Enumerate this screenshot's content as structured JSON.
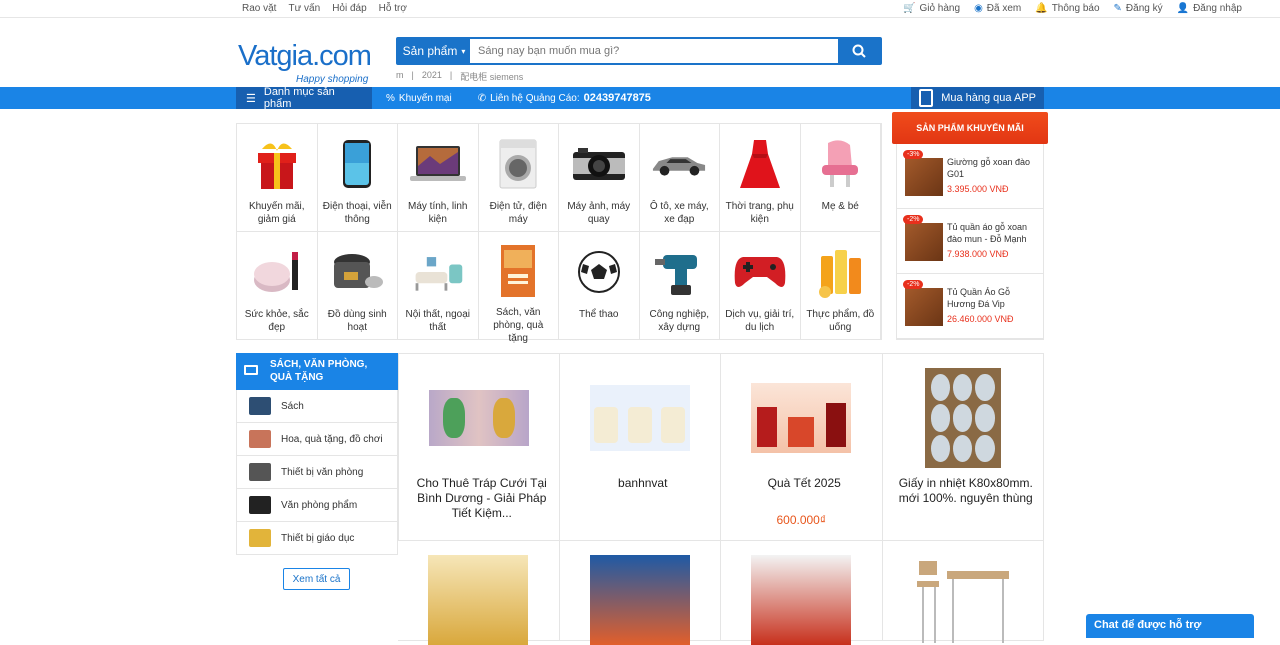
{
  "topbar": {
    "left": [
      "Rao vặt",
      "Tư vấn",
      "Hỏi đáp",
      "Hỗ trợ"
    ],
    "right": [
      "Giỏ hàng",
      "Đã xem",
      "Thông báo",
      "Đăng ký",
      "Đăng nhập"
    ]
  },
  "logo": {
    "word": "Vatgia.com",
    "tagline": "Happy shopping"
  },
  "search": {
    "category": "Sản phẩm",
    "placeholder": "Sáng nay bạn muốn mua gì?",
    "hints": [
      "m",
      "|",
      "2021",
      "|",
      "配电柜 siemens"
    ]
  },
  "nav": {
    "categories": "Danh mục sản phẩm",
    "promo": "Khuyến mại",
    "contact": "Liên hệ Quảng Cáo: ",
    "phone": "02439747875",
    "app": "Mua hàng qua APP"
  },
  "categories": [
    {
      "label": "Khuyến mãi, giảm giá",
      "icon": "gift-icon"
    },
    {
      "label": "Điện thoại, viễn thông",
      "icon": "phone-icon"
    },
    {
      "label": "Máy tính, linh kiện",
      "icon": "laptop-icon"
    },
    {
      "label": "Điện tử, điện máy",
      "icon": "washer-icon"
    },
    {
      "label": "Máy ảnh, máy quay",
      "icon": "camera-icon"
    },
    {
      "label": "Ô tô, xe máy, xe đạp",
      "icon": "car-icon"
    },
    {
      "label": "Thời trang, phụ kiện",
      "icon": "dress-icon"
    },
    {
      "label": "Mẹ & bé",
      "icon": "baby-chair-icon"
    },
    {
      "label": "Sức khỏe, sắc đẹp",
      "icon": "cosmetics-icon"
    },
    {
      "label": "Đồ dùng sinh hoạt",
      "icon": "rice-cooker-icon"
    },
    {
      "label": "Nội thất, ngoại thất",
      "icon": "furniture-icon"
    },
    {
      "label": "Sách, văn phòng, quà tặng",
      "icon": "book-icon"
    },
    {
      "label": "Thể thao",
      "icon": "football-icon"
    },
    {
      "label": "Công nghiệp, xây dựng",
      "icon": "drill-icon"
    },
    {
      "label": "Dịch vụ, giải trí, du lịch",
      "icon": "gamepad-icon"
    },
    {
      "label": "Thực phẩm, đồ uống",
      "icon": "juice-icon"
    }
  ],
  "promo": {
    "title": "SẢN PHẨM KHUYẾN MÃI",
    "items": [
      {
        "discount": "-3%",
        "name": "Giường gỗ xoan đào G01",
        "price": "3.395.000 VNĐ"
      },
      {
        "discount": "-2%",
        "name": "Tủ quần áo gỗ xoan đào mun - Đỗ Mạnh",
        "price": "7.938.000 VNĐ"
      },
      {
        "discount": "-2%",
        "name": "Tủ Quần Áo Gỗ Hương Đá Vip",
        "price": "26.460.000 VNĐ"
      }
    ]
  },
  "sidebar": {
    "title": "SÁCH, VĂN PHÒNG, QUÀ TẶNG",
    "items": [
      "Sách",
      "Hoa, quà tặng, đồ chơi",
      "Thiết bị văn phòng",
      "Văn phòng phẩm",
      "Thiết bị giáo dục"
    ],
    "see_all": "Xem tất cả"
  },
  "products": [
    {
      "title": "Cho Thuê Tráp Cưới Tại Bình Dương - Giải Pháp Tiết Kiệm...",
      "price": ""
    },
    {
      "title": "banhnvat",
      "price": ""
    },
    {
      "title": "Quà Tết 2025",
      "price": "600.000₫"
    },
    {
      "title": "Giấy in nhiệt K80x80mm. mới 100%. nguyên thùng",
      "price": ""
    },
    {
      "title": "",
      "price": ""
    },
    {
      "title": "",
      "price": ""
    },
    {
      "title": "",
      "price": ""
    },
    {
      "title": "",
      "price": ""
    }
  ],
  "chat": "Chat để được hỗ trợ",
  "colors": {
    "primary": "#1a84e6",
    "dark": "#175fb0",
    "accent": "#e8301c",
    "price": "#e8561c"
  }
}
